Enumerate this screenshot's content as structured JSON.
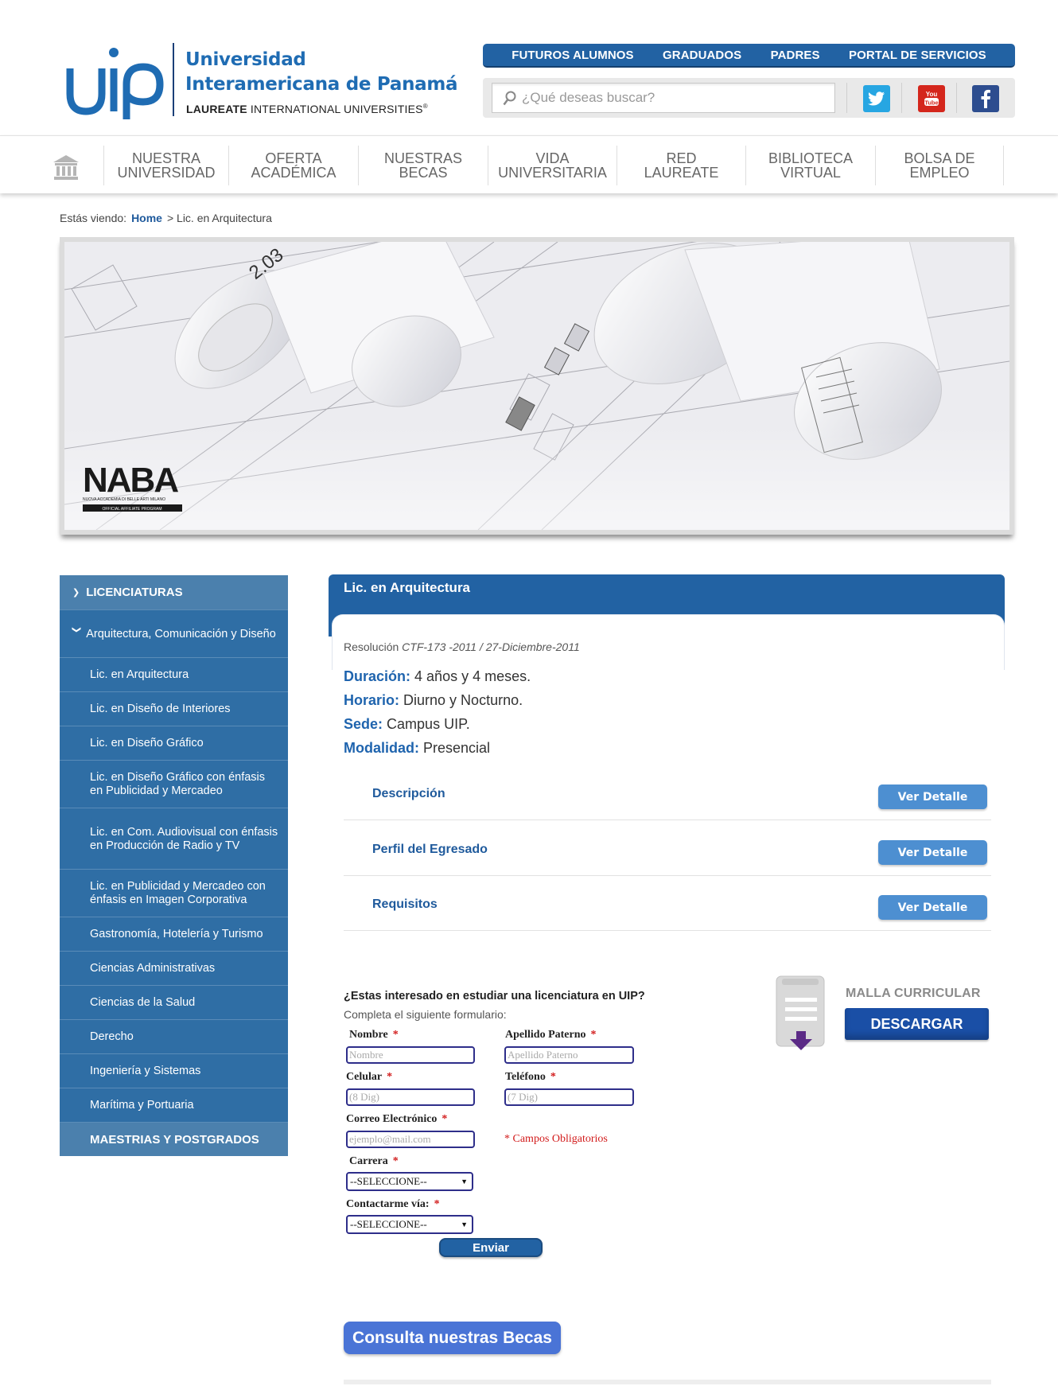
{
  "header": {
    "logo_mark": "uip",
    "logo_name_line1": "Universidad",
    "logo_name_line2": "Interamericana de Panamá",
    "logo_laureate_bold": "LAUREATE",
    "logo_laureate_rest": "INTERNATIONAL UNIVERSITIES",
    "top_links": [
      "FUTUROS ALUMNOS",
      "GRADUADOS",
      "PADRES",
      "PORTAL DE SERVICIOS"
    ],
    "search_placeholder": "¿Qué deseas buscar?",
    "social_icons": [
      "twitter-icon",
      "youtube-icon",
      "facebook-icon"
    ]
  },
  "mainnav": {
    "home_icon": "home-building-icon",
    "items": [
      {
        "line1": "NUESTRA",
        "line2": "UNIVERSIDAD"
      },
      {
        "line1": "OFERTA",
        "line2": "ACADÉMICA"
      },
      {
        "line1": "NUESTRAS",
        "line2": "BECAS"
      },
      {
        "line1": "VIDA",
        "line2": "UNIVERSITARIA"
      },
      {
        "line1": "RED",
        "line2": "LAUREATE"
      },
      {
        "line1": "BIBLIOTECA",
        "line2": "VIRTUAL"
      },
      {
        "line1": "BOLSA DE",
        "line2": "EMPLEO"
      }
    ]
  },
  "breadcrumb": {
    "prefix": "Estás viendo:",
    "home": "Home",
    "current": "> Lic. en Arquitectura"
  },
  "banner": {
    "number_label": "2.03",
    "partner_logo": "NABA",
    "partner_subtitle": "NUOVA ACCADEMIA DI BELLE ARTI MILANO",
    "partner_tag": "OFFICIAL AFFILIATE PROGRAM"
  },
  "sidebar": {
    "head": "LICENCIATURAS",
    "group": "Arquitectura, Comunicación y Diseño",
    "items": [
      "Lic. en Arquitectura",
      "Lic. en Diseño de Interiores",
      "Lic. en Diseño Gráfico",
      "Lic. en Diseño Gráfico con énfasis en Publicidad y Mercadeo",
      "Lic. en Com. Audiovisual con énfasis en Producción de Radio y TV",
      "Lic. en Publicidad y Mercadeo con énfasis en Imagen Corporativa",
      "Gastronomía, Hotelería y Turismo",
      "Ciencias Administrativas",
      "Ciencias de la Salud",
      "Derecho",
      "Ingeniería y Sistemas",
      "Marítima y Portuaria"
    ],
    "foot": "MAESTRIAS Y POSTGRADOS"
  },
  "program": {
    "title": "Lic. en Arquitectura",
    "resolution_label": "Resolución",
    "resolution_value": "CTF-173 -2011 / 27-Diciembre-2011",
    "info": [
      {
        "label": "Duración:",
        "value": "4 años y 4 meses."
      },
      {
        "label": "Horario:",
        "value": "Diurno y Nocturno."
      },
      {
        "label": "Sede:",
        "value": "Campus UIP."
      },
      {
        "label": "Modalidad:",
        "value": "Presencial"
      }
    ],
    "details": [
      {
        "label": "Descripción",
        "button": "Ver Detalle"
      },
      {
        "label": "Perfil del Egresado",
        "button": "Ver Detalle"
      },
      {
        "label": "Requisitos",
        "button": "Ver Detalle"
      }
    ]
  },
  "form": {
    "question": "¿Estas interesado en estudiar una licenciatura en UIP?",
    "subtitle": "Completa el siguiente formulario:",
    "nombre_label": "Nombre",
    "nombre_placeholder": "Nombre",
    "apellido_label": "Apellido Paterno",
    "apellido_placeholder": "Apellido Paterno",
    "celular_label": "Celular",
    "celular_placeholder": "(8 Dig)",
    "telefono_label": "Teléfono",
    "telefono_placeholder": "(7 Dig)",
    "correo_label": "Correo Electrónico",
    "correo_placeholder": "ejemplo@mail.com",
    "carrera_label": "Carrera",
    "carrera_value": "--SELECCIONE--",
    "contacto_label": "Contactarme vía:",
    "contacto_value": "--SELECCIONE--",
    "required_mark": "*",
    "required_note": "* Campos Obligatorios",
    "submit": "Enviar"
  },
  "malla": {
    "label": "MALLA CURRICULAR",
    "button": "DESCARGAR"
  },
  "becas_button": "Consulta nuestras Becas",
  "colors": {
    "brand_blue": "#2262a3",
    "sidebar_blue": "#2f6ea5",
    "link_blue": "#1f64ae",
    "required_red": "#d21b1b"
  }
}
